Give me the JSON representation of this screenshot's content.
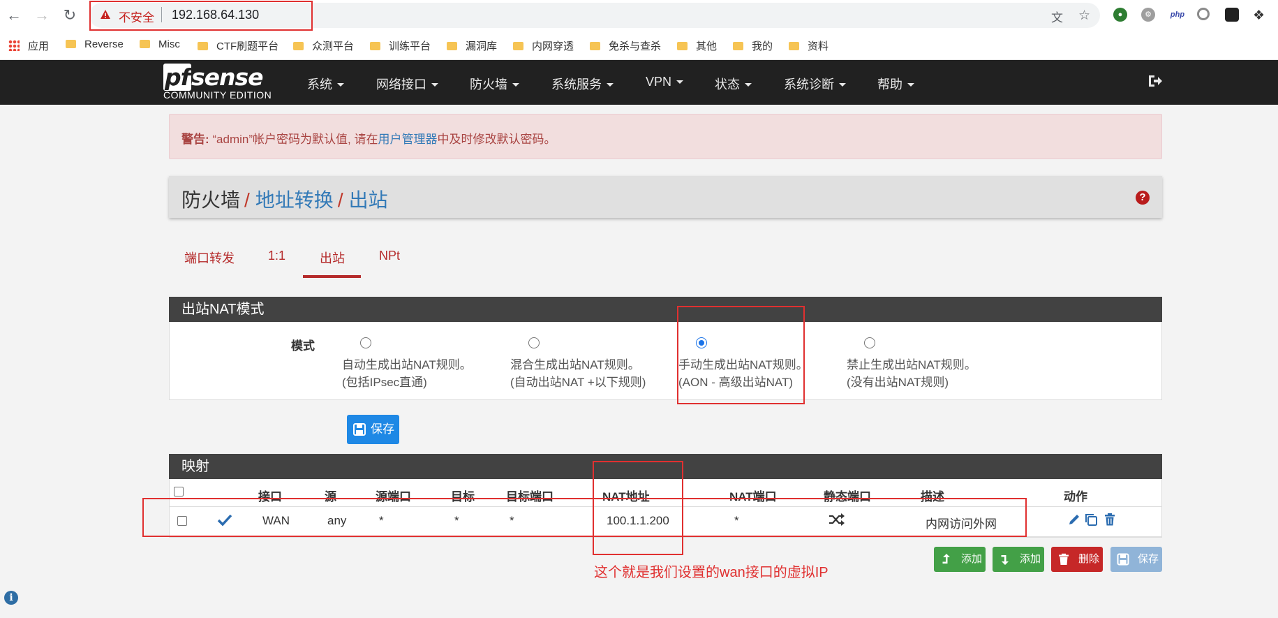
{
  "browser": {
    "insecure_label": "不安全",
    "url": "192.168.64.130",
    "bookmarks": [
      "应用",
      "Reverse",
      "Misc",
      "CTF刷题平台",
      "众测平台",
      "训练平台",
      "漏洞库",
      "内网穿透",
      "免杀与查杀",
      "其他",
      "我的",
      "资料"
    ],
    "ext_php": "php"
  },
  "logo": {
    "brand_pf": "pf",
    "brand_rest": "sense",
    "edition": "COMMUNITY EDITION"
  },
  "nav": {
    "items": [
      "系统",
      "网络接口",
      "防火墙",
      "系统服务",
      "VPN",
      "状态",
      "系统诊断",
      "帮助"
    ]
  },
  "warning": {
    "prefix": "警告:",
    "text_before": " “admin”帐户密码为默认值, 请在",
    "link": "用户管理器",
    "text_after": "中及时修改默认密码。"
  },
  "breadcrumb": {
    "root": "防火墙",
    "sep": "/",
    "level2": "地址转换",
    "level3": "出站"
  },
  "tabs": [
    "端口转发",
    "1:1",
    "出站",
    "NPt"
  ],
  "nat_mode": {
    "panel_title": "出站NAT模式",
    "label": "模式",
    "options": [
      {
        "line1": "自动生成出站NAT规则。",
        "line2": "(包括IPsec直通)",
        "selected": false
      },
      {
        "line1": "混合生成出站NAT规则。",
        "line2": "(自动出站NAT +以下规则)",
        "selected": false
      },
      {
        "line1": "手动生成出站NAT规则。",
        "line2": "(AON - 高级出站NAT)",
        "selected": true
      },
      {
        "line1": "禁止生成出站NAT规则。",
        "line2": "(没有出站NAT规则)",
        "selected": false
      }
    ],
    "save_label": "保存"
  },
  "mappings": {
    "panel_title": "映射",
    "columns": [
      "接口",
      "源",
      "源端口",
      "目标",
      "目标端口",
      "NAT地址",
      "NAT端口",
      "静态端口",
      "描述",
      "动作"
    ],
    "rows": [
      {
        "interface": "WAN",
        "source": "any",
        "source_port": "*",
        "destination": "*",
        "destination_port": "*",
        "nat_address": "100.1.1.200",
        "nat_port": "*",
        "description": "内网访问外网"
      }
    ],
    "buttons": {
      "add_top": "添加",
      "add_bottom": "添加",
      "delete": "删除",
      "save": "保存"
    }
  },
  "annotation": "这个就是我们设置的wan接口的虚拟IP",
  "colors": {
    "navbar": "#212121",
    "accent_red": "#b52b2b",
    "link_blue": "#337ab7",
    "highlight": "#e03030"
  }
}
